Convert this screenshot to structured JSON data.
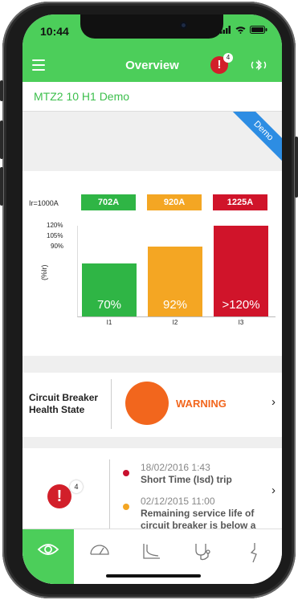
{
  "status_bar": {
    "time": "10:44"
  },
  "header": {
    "title": "Overview",
    "alert_count": "4",
    "alert_symbol": "!"
  },
  "device": {
    "name": "MTZ2 10 H1 Demo"
  },
  "ribbon": {
    "label": "Demo"
  },
  "chart_data": {
    "type": "bar",
    "rating_label": "Ir=1000A",
    "ylabel": "(%Ir)",
    "y_ticks": [
      "120%",
      "105%",
      "90%"
    ],
    "categories": [
      "I1",
      "I2",
      "I3"
    ],
    "current_values": [
      "702A",
      "920A",
      "1225A"
    ],
    "values": [
      70,
      92,
      120
    ],
    "value_labels": [
      "70%",
      "92%",
      ">120%"
    ],
    "ylim": [
      0,
      120
    ],
    "colors": [
      "#2fb545",
      "#f4a623",
      "#d0142a"
    ]
  },
  "health": {
    "label_line1": "Circuit Breaker",
    "label_line2": "Health State",
    "state": "WARNING",
    "color": "#f2661d"
  },
  "alarms": {
    "count": "4",
    "symbol": "!",
    "events": [
      {
        "date": "18/02/2016 1:43",
        "text": "Short Time (Isd) trip",
        "color": "#c8102e"
      },
      {
        "date": "02/12/2015 11:00",
        "text": "Remaining service life of circuit breaker is below a",
        "color": "#f4a623"
      }
    ]
  },
  "tabs": [
    {
      "name": "overview",
      "icon": "eye-icon"
    },
    {
      "name": "measures",
      "icon": "gauge-icon"
    },
    {
      "name": "curves",
      "icon": "curve-icon"
    },
    {
      "name": "diagnostics",
      "icon": "stethoscope-icon"
    },
    {
      "name": "tripping",
      "icon": "lightning-icon"
    }
  ],
  "chevron": "›"
}
